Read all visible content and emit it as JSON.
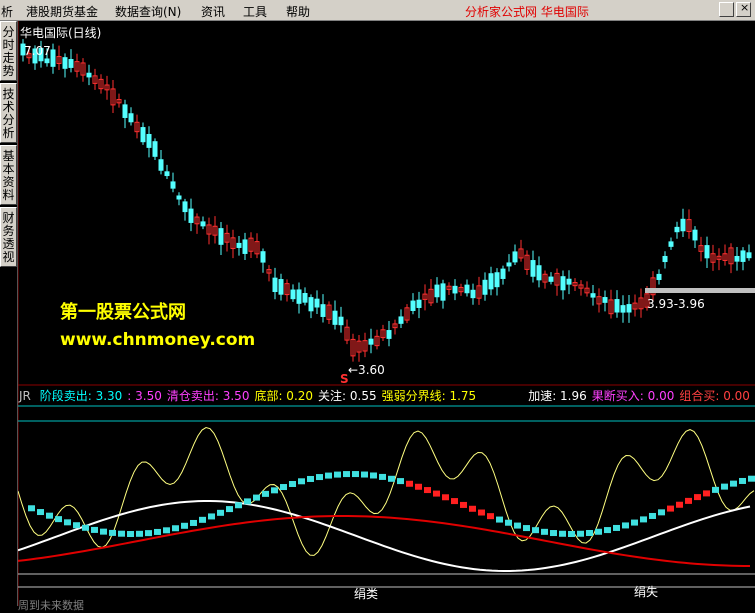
{
  "menu": {
    "items": [
      "析",
      "港股期货基金",
      "数据查询(N)",
      "资讯",
      "工具",
      "帮助"
    ],
    "brand": "分析家公式网  华电国际"
  },
  "sidebar": {
    "tabs": [
      "分时走势",
      "技术分析",
      "基本资料",
      "财务透视"
    ]
  },
  "chart": {
    "title": "华电国际(日线)",
    "high_label": "7.07",
    "low_label": "←3.60",
    "low_marker": "S",
    "range_label": "3.93-3.96",
    "watermark_title": "第一股票公式网",
    "watermark_url": "www.chnmoney.com"
  },
  "indicator": {
    "prefix": "JR",
    "items": [
      {
        "label": "阶段卖出:",
        "value": "3.30",
        "color": "#00ffff"
      },
      {
        "label": ":",
        "value": "3.50",
        "color": "#ff40ff"
      },
      {
        "label": "清仓卖出:",
        "value": "3.50",
        "color": "#ff40ff"
      },
      {
        "label": "底部:",
        "value": "0.20",
        "color": "#ffff00"
      },
      {
        "label": "关注:",
        "value": "0.55",
        "color": "#ffffff"
      },
      {
        "label": "强弱分界线:",
        "value": "1.75",
        "color": "#ffff00"
      },
      {
        "label": "加速:",
        "value": "1.96",
        "color": "#ffffff"
      },
      {
        "label": "果断买入:",
        "value": "0.00",
        "color": "#ff40ff"
      },
      {
        "label": "组合买:",
        "value": "0.00",
        "color": "#ff4040"
      }
    ],
    "signal_text": [
      "绢类",
      "绢失"
    ],
    "bottom_text": "周到未来数据"
  },
  "colors": {
    "candle_up": "#ff3030",
    "candle_down": "#54ffff",
    "grid": "#8b0000",
    "accent": "#e00000"
  }
}
